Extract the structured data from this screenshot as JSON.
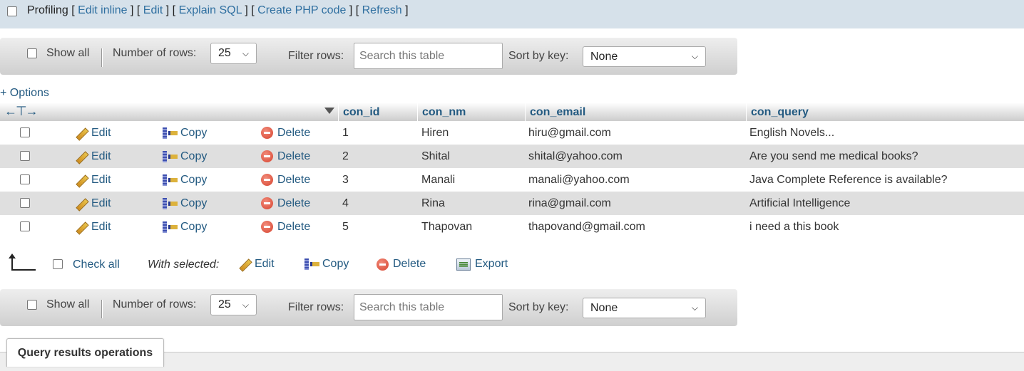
{
  "profiling": {
    "label": "Profiling",
    "links": [
      "Edit inline",
      "Edit",
      "Explain SQL",
      "Create PHP code",
      "Refresh"
    ]
  },
  "navigation": {
    "show_all": "Show all",
    "number_of_rows_label": "Number of rows:",
    "rows_value": "25",
    "filter_label": "Filter rows:",
    "filter_placeholder": "Search this table",
    "sort_label": "Sort by key:",
    "sort_value": "None"
  },
  "options_link": "+ Options",
  "table": {
    "columns": [
      "con_id",
      "con_nm",
      "con_email",
      "con_query"
    ],
    "actions": {
      "edit": "Edit",
      "copy": "Copy",
      "delete": "Delete"
    },
    "rows": [
      {
        "con_id": "1",
        "con_nm": "Hiren",
        "con_email": "hiru@gmail.com",
        "con_query": "English Novels..."
      },
      {
        "con_id": "2",
        "con_nm": "Shital",
        "con_email": "shital@yahoo.com",
        "con_query": "Are you send me medical books?"
      },
      {
        "con_id": "3",
        "con_nm": "Manali",
        "con_email": "manali@yahoo.com",
        "con_query": "Java Complete Reference is available?"
      },
      {
        "con_id": "4",
        "con_nm": "Rina",
        "con_email": "rina@gmail.com",
        "con_query": "Artificial Intelligence"
      },
      {
        "con_id": "5",
        "con_nm": "Thapovan",
        "con_email": "thapovand@gmail.com",
        "con_query": "i need a this book"
      }
    ]
  },
  "with_selected": {
    "check_all": "Check all",
    "label": "With selected:",
    "edit": "Edit",
    "copy": "Copy",
    "delete": "Delete",
    "export": "Export"
  },
  "query_results_operations": "Query results operations"
}
